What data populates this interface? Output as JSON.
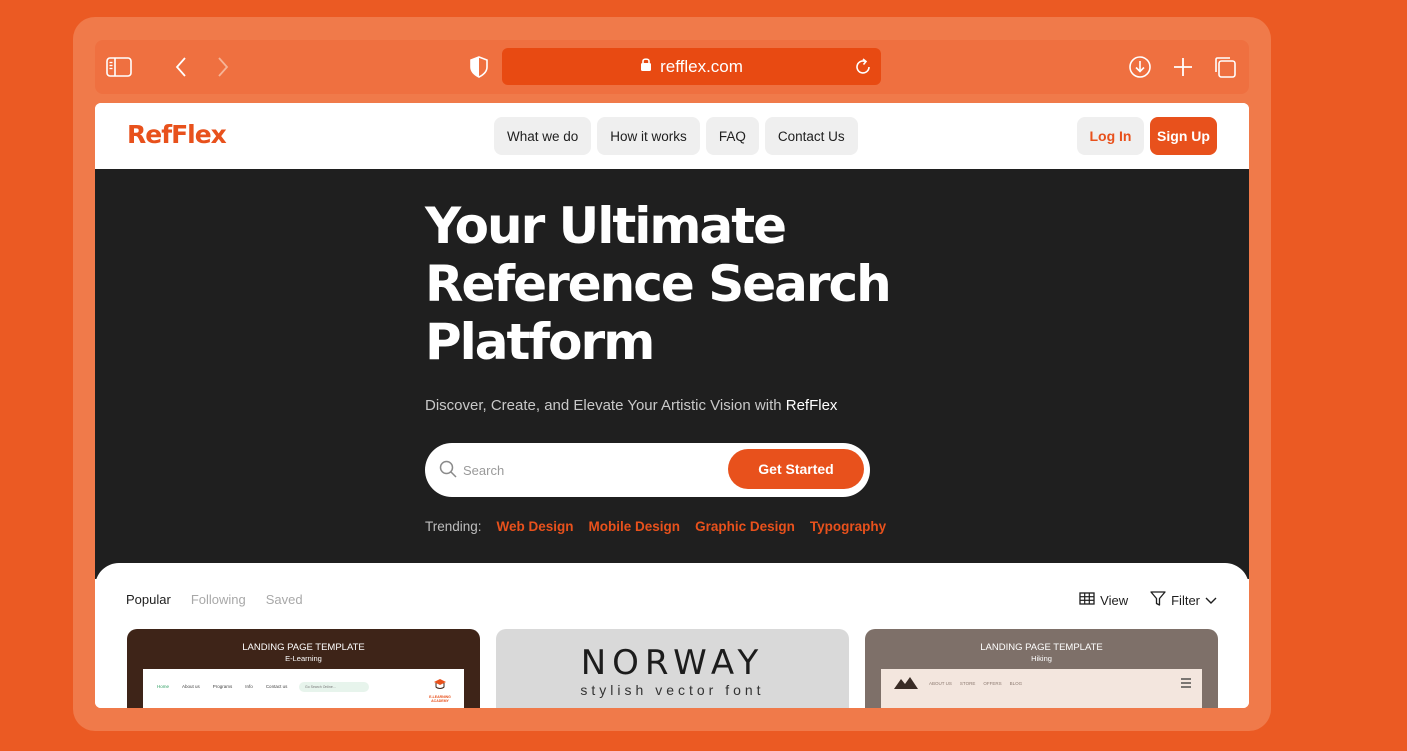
{
  "browser": {
    "url": "refflex.com",
    "icons": [
      "sidebar-icon",
      "back-arrow-icon",
      "forward-arrow-icon",
      "shield-icon",
      "lock-icon",
      "reload-icon",
      "download-icon",
      "plus-icon",
      "tabs-icon"
    ]
  },
  "nav": {
    "logo": "RefFlex",
    "links": [
      "What we do",
      "How it works",
      "FAQ",
      "Contact Us"
    ],
    "login": "Log In",
    "signup": "Sign Up"
  },
  "hero": {
    "title_lines": [
      "Your Ultimate",
      "Reference Search",
      "Platform"
    ],
    "subtitle": "Discover, Create, and Elevate Your Artistic Vision with",
    "subtitle_brand": "RefFlex",
    "search_placeholder": "Search",
    "cta": "Get Started",
    "trending_label": "Trending:",
    "trending": [
      "Web Design",
      "Mobile Design",
      "Graphic Design",
      "Typography"
    ]
  },
  "feed": {
    "tabs": [
      "Popular",
      "Following",
      "Saved"
    ],
    "active_tab": "Popular",
    "view_label": "View",
    "filter_label": "Filter"
  },
  "cards": [
    {
      "title": "LANDING PAGE TEMPLATE",
      "subtitle": "E-Learning",
      "mock_nav": [
        "Home",
        "About us",
        "Programs",
        "Info",
        "Contact us"
      ],
      "mock_search": "Go Search Online...",
      "mock_brand": "E-LEARNING ACADEMY"
    },
    {
      "title": "NORWAY",
      "subtitle": "stylish vector font"
    },
    {
      "title": "LANDING PAGE TEMPLATE",
      "subtitle": "Hiking",
      "mock_nav": [
        "ABOUT US",
        "STORE",
        "OFFERS",
        "BLOG"
      ]
    }
  ],
  "colors": {
    "accent": "#E8511C",
    "background": "#EB5A23",
    "hero_bg": "#1F1F1F"
  }
}
